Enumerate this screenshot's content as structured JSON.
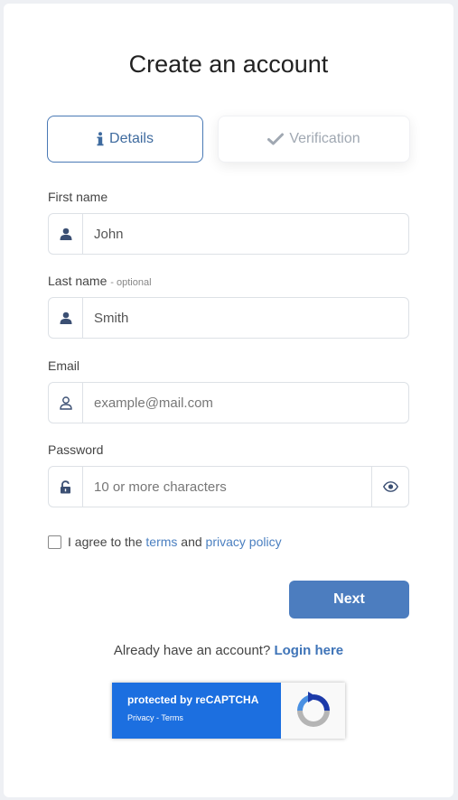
{
  "title": "Create an account",
  "tabs": [
    {
      "label": "Details",
      "icon": "info-icon",
      "active": true
    },
    {
      "label": "Verification",
      "icon": "check-icon",
      "active": false
    }
  ],
  "fields": {
    "first_name": {
      "label": "First name",
      "value": "John",
      "icon": "user-icon"
    },
    "last_name": {
      "label": "Last name",
      "optional": "- optional",
      "value": "Smith",
      "icon": "user-icon"
    },
    "email": {
      "label": "Email",
      "placeholder": "example@mail.com",
      "icon": "user-outline-icon"
    },
    "password": {
      "label": "Password",
      "placeholder": "10 or more characters",
      "icon": "unlock-icon",
      "toggle_icon": "eye-icon"
    }
  },
  "agree": {
    "prefix": "I agree to the",
    "terms": "terms",
    "and": "and",
    "privacy": "privacy policy",
    "checked": false
  },
  "next_label": "Next",
  "login": {
    "prompt": "Already have an account?",
    "link": "Login here"
  },
  "recaptcha": {
    "title": "protected by reCAPTCHA",
    "privacy": "Privacy",
    "separator": "-",
    "terms": "Terms"
  },
  "colors": {
    "accent": "#4c7dbf",
    "link": "#4a7fc0",
    "recaptcha_blue": "#1c6fe0"
  }
}
